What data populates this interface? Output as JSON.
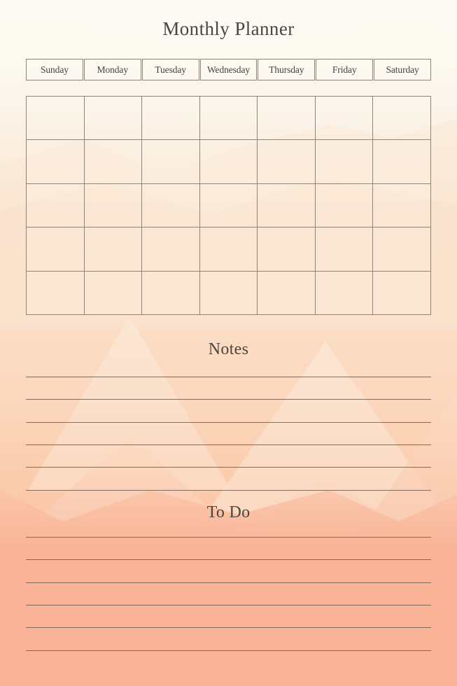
{
  "page": {
    "title": "Monthly Planner",
    "background_top_color": "#fdfaf3",
    "background_bottom_color": "#f9b296",
    "ink_color": "#494540",
    "rule_color": "#6e5b4e",
    "grid_border_color": "#8c857a",
    "mountain_colors": [
      "#fbe0cb",
      "#fbd3b8",
      "#fac2a4",
      "#f9b79a"
    ]
  },
  "calendar": {
    "weekday_headers": [
      "Sunday",
      "Monday",
      "Tuesday",
      "Wednesday",
      "Thursday",
      "Friday",
      "Saturday"
    ],
    "columns": 7,
    "rows": 5,
    "cells": [
      [
        "",
        "",
        "",
        "",
        "",
        "",
        ""
      ],
      [
        "",
        "",
        "",
        "",
        "",
        "",
        ""
      ],
      [
        "",
        "",
        "",
        "",
        "",
        "",
        ""
      ],
      [
        "",
        "",
        "",
        "",
        "",
        "",
        ""
      ],
      [
        "",
        "",
        "",
        "",
        "",
        "",
        ""
      ]
    ]
  },
  "notes": {
    "title": "Notes",
    "line_count": 6,
    "lines": [
      "",
      "",
      "",
      "",
      "",
      ""
    ]
  },
  "todo": {
    "title": "To Do",
    "line_count": 6,
    "lines": [
      "",
      "",
      "",
      "",
      "",
      ""
    ]
  }
}
